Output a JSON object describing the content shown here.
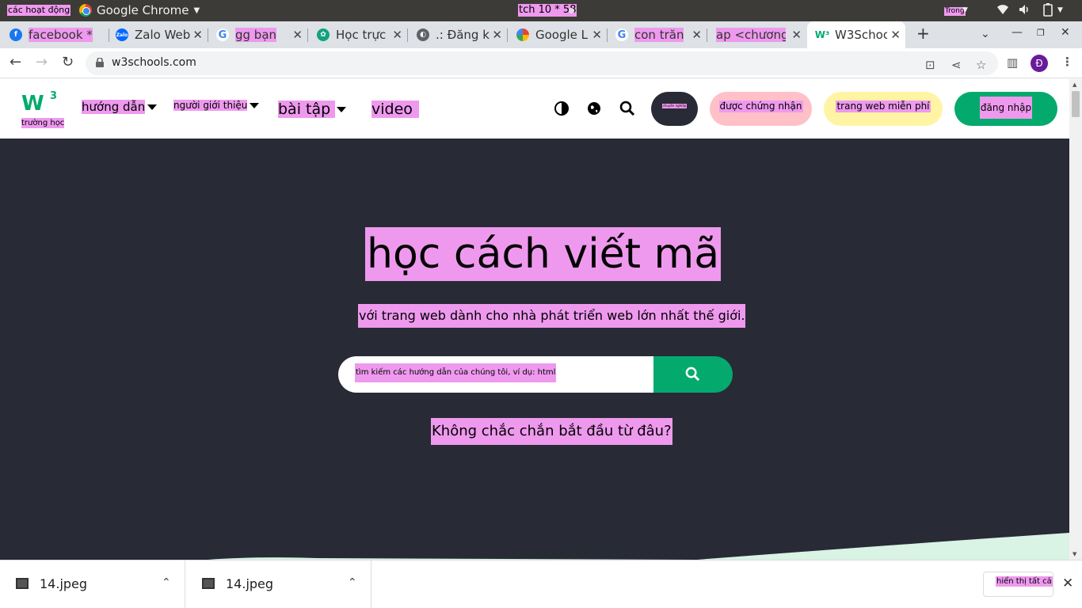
{
  "topbar": {
    "activities": "các hoạt động",
    "app_name": "Google Chrome",
    "clock": "tch 10 * 58",
    "lang": "Trong"
  },
  "tabs": [
    {
      "title": "facebook *",
      "favicon": "facebook-icon",
      "color": "#1877f2"
    },
    {
      "title": "Zalo Web",
      "favicon": "zalo-icon",
      "color": "#0068ff"
    },
    {
      "title": "gg bạn",
      "favicon": "google-icon",
      "color": "#4285f4"
    },
    {
      "title": "Học trực",
      "favicon": "chatgpt-icon",
      "color": "#10a37f"
    },
    {
      "title": ".: Đăng k",
      "favicon": "globe-icon",
      "color": "#5f6368"
    },
    {
      "title": "Google L",
      "favicon": "google-lens-icon",
      "color": "#ea4335"
    },
    {
      "title": "con trăn",
      "favicon": "google-icon",
      "color": "#4285f4"
    },
    {
      "title": "ap <chương",
      "favicon": "",
      "color": ""
    },
    {
      "title": "W3Schoo",
      "favicon": "w3schools-icon",
      "color": "#04aa6d"
    }
  ],
  "address_bar": {
    "url": "w3schools.com",
    "profile_initial": "Đ"
  },
  "w3nav": {
    "logo_label": "trường học",
    "tutorials": "hướng dẫn",
    "references": "người giới thiệu",
    "exercises": "bài tập",
    "videos": "video",
    "pro_label": "chuyên nghiệp",
    "certified": "được chứng nhận",
    "spaces": "trang web miễn phí",
    "login": "đăng nhập"
  },
  "hero": {
    "title": "học cách viết mã",
    "subtitle": "với trang web dành cho nhà phát triển web lớn nhất thế giới.",
    "search_placeholder": "tìm kiếm các hướng dẫn của chúng tôi, ví dụ: html",
    "not_sure": "Không chắc chắn bắt đầu từ đâu?"
  },
  "colors": {
    "w3_green": "#04aa6d",
    "hero_bg": "#282a35",
    "highlight": "#ee99ee",
    "certified_pill": "#ffc0c7",
    "spaces_pill": "#fff4a3"
  },
  "downloads": {
    "items": [
      {
        "name": "14.jpeg"
      },
      {
        "name": "14.jpeg"
      }
    ],
    "show_all": "hiển thị tất cả"
  }
}
